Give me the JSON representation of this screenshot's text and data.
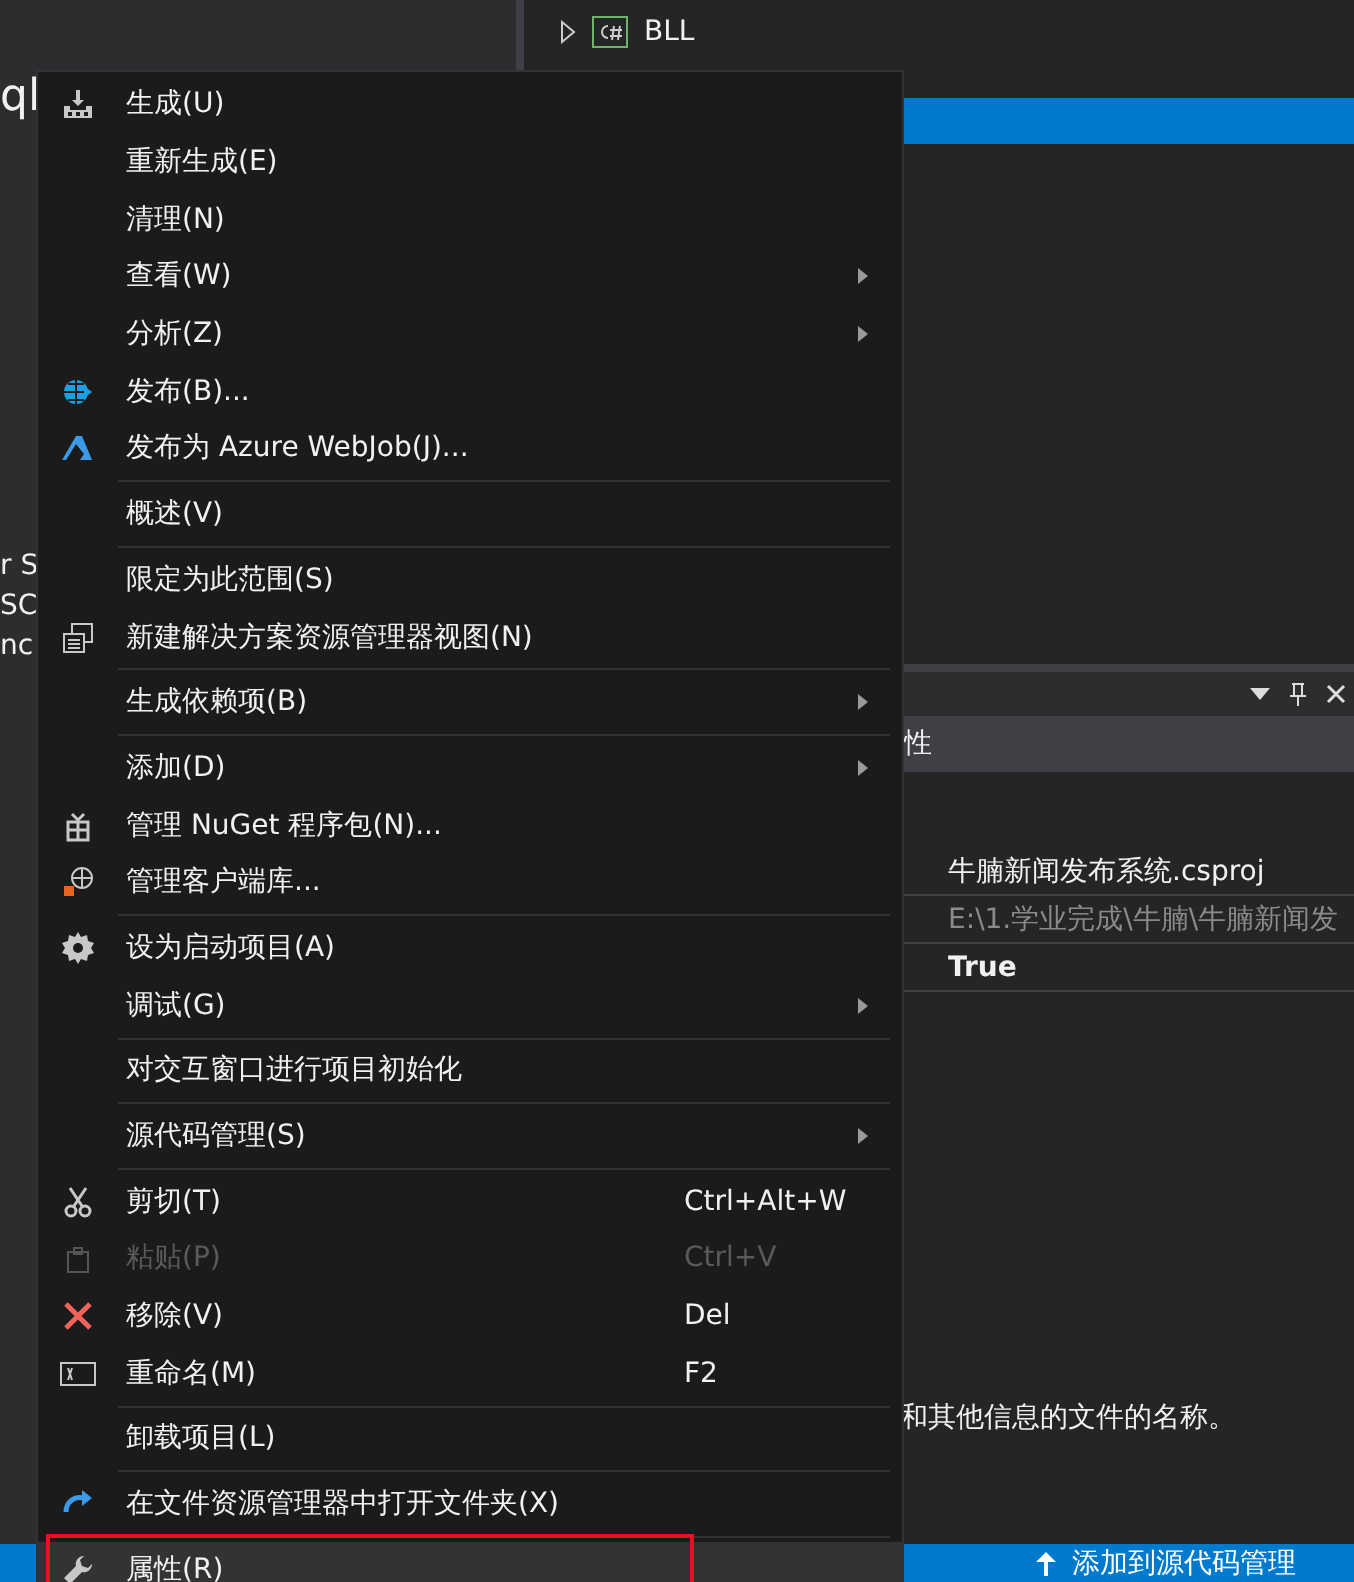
{
  "left_panel": {
    "texts": [
      "ql",
      "r S",
      "SC",
      "nc"
    ]
  },
  "solution_explorer": {
    "items": [
      {
        "label": "BLL",
        "expanded": false,
        "selected": false
      },
      {
        "selected": true
      }
    ]
  },
  "properties": {
    "tab": "性",
    "rows": [
      {
        "value": "牛腩新闻发布系统.csproj",
        "disabled": false,
        "modified": false
      },
      {
        "value": "E:\\1.学业完成\\牛腩\\牛腩新闻发",
        "disabled": true,
        "modified": false
      },
      {
        "value": "True",
        "disabled": false,
        "modified": true
      }
    ],
    "description": "和其他信息的文件的名称。"
  },
  "status_bar": {
    "text": "添加到源代码管理"
  },
  "context_menu": {
    "items": [
      {
        "kind": "item",
        "label": "生成(U)",
        "submenu": false,
        "disabled": false,
        "selected": false
      },
      {
        "kind": "item",
        "label": "重新生成(E)",
        "submenu": false,
        "disabled": false,
        "selected": false
      },
      {
        "kind": "item",
        "label": "清理(N)",
        "submenu": false,
        "disabled": false,
        "selected": false
      },
      {
        "kind": "item",
        "label": "查看(W)",
        "submenu": true,
        "disabled": false,
        "selected": false
      },
      {
        "kind": "item",
        "label": "分析(Z)",
        "submenu": true,
        "disabled": false,
        "selected": false
      },
      {
        "kind": "item",
        "label": "发布(B)...",
        "submenu": false,
        "disabled": false,
        "selected": false
      },
      {
        "kind": "item",
        "label": "发布为 Azure WebJob(J)...",
        "submenu": false,
        "disabled": false,
        "selected": false
      },
      {
        "kind": "separator"
      },
      {
        "kind": "item",
        "label": "概述(V)",
        "submenu": false,
        "disabled": false,
        "selected": false
      },
      {
        "kind": "separator"
      },
      {
        "kind": "item",
        "label": "限定为此范围(S)",
        "submenu": false,
        "disabled": false,
        "selected": false
      },
      {
        "kind": "item",
        "label": "新建解决方案资源管理器视图(N)",
        "submenu": false,
        "disabled": false,
        "selected": false
      },
      {
        "kind": "separator"
      },
      {
        "kind": "item",
        "label": "生成依赖项(B)",
        "submenu": true,
        "disabled": false,
        "selected": false
      },
      {
        "kind": "separator"
      },
      {
        "kind": "item",
        "label": "添加(D)",
        "submenu": true,
        "disabled": false,
        "selected": false
      },
      {
        "kind": "item",
        "label": "管理 NuGet 程序包(N)...",
        "submenu": false,
        "disabled": false,
        "selected": false
      },
      {
        "kind": "item",
        "label": "管理客户端库...",
        "submenu": false,
        "disabled": false,
        "selected": false
      },
      {
        "kind": "separator"
      },
      {
        "kind": "item",
        "label": "设为启动项目(A)",
        "submenu": false,
        "disabled": false,
        "selected": false
      },
      {
        "kind": "item",
        "label": "调试(G)",
        "submenu": true,
        "disabled": false,
        "selected": false
      },
      {
        "kind": "separator"
      },
      {
        "kind": "item",
        "label": "对交互窗口进行项目初始化",
        "submenu": false,
        "disabled": false,
        "selected": false
      },
      {
        "kind": "separator"
      },
      {
        "kind": "item",
        "label": "源代码管理(S)",
        "submenu": true,
        "disabled": false,
        "selected": false
      },
      {
        "kind": "separator"
      },
      {
        "kind": "item",
        "label": "剪切(T)",
        "shortcut": "Ctrl+Alt+W",
        "submenu": false,
        "disabled": false,
        "selected": false
      },
      {
        "kind": "item",
        "label": "粘贴(P)",
        "shortcut": "Ctrl+V",
        "submenu": false,
        "disabled": true,
        "selected": false
      },
      {
        "kind": "item",
        "label": "移除(V)",
        "shortcut": "Del",
        "submenu": false,
        "disabled": false,
        "selected": false
      },
      {
        "kind": "item",
        "label": "重命名(M)",
        "shortcut": "F2",
        "submenu": false,
        "disabled": false,
        "selected": false
      },
      {
        "kind": "separator"
      },
      {
        "kind": "item",
        "label": "卸载项目(L)",
        "submenu": false,
        "disabled": false,
        "selected": false
      },
      {
        "kind": "separator"
      },
      {
        "kind": "item",
        "label": "在文件资源管理器中打开文件夹(X)",
        "submenu": false,
        "disabled": false,
        "selected": false
      },
      {
        "kind": "separator"
      },
      {
        "kind": "item",
        "label": "属性(R)",
        "submenu": false,
        "disabled": false,
        "selected": true,
        "highlighted": true
      }
    ]
  }
}
